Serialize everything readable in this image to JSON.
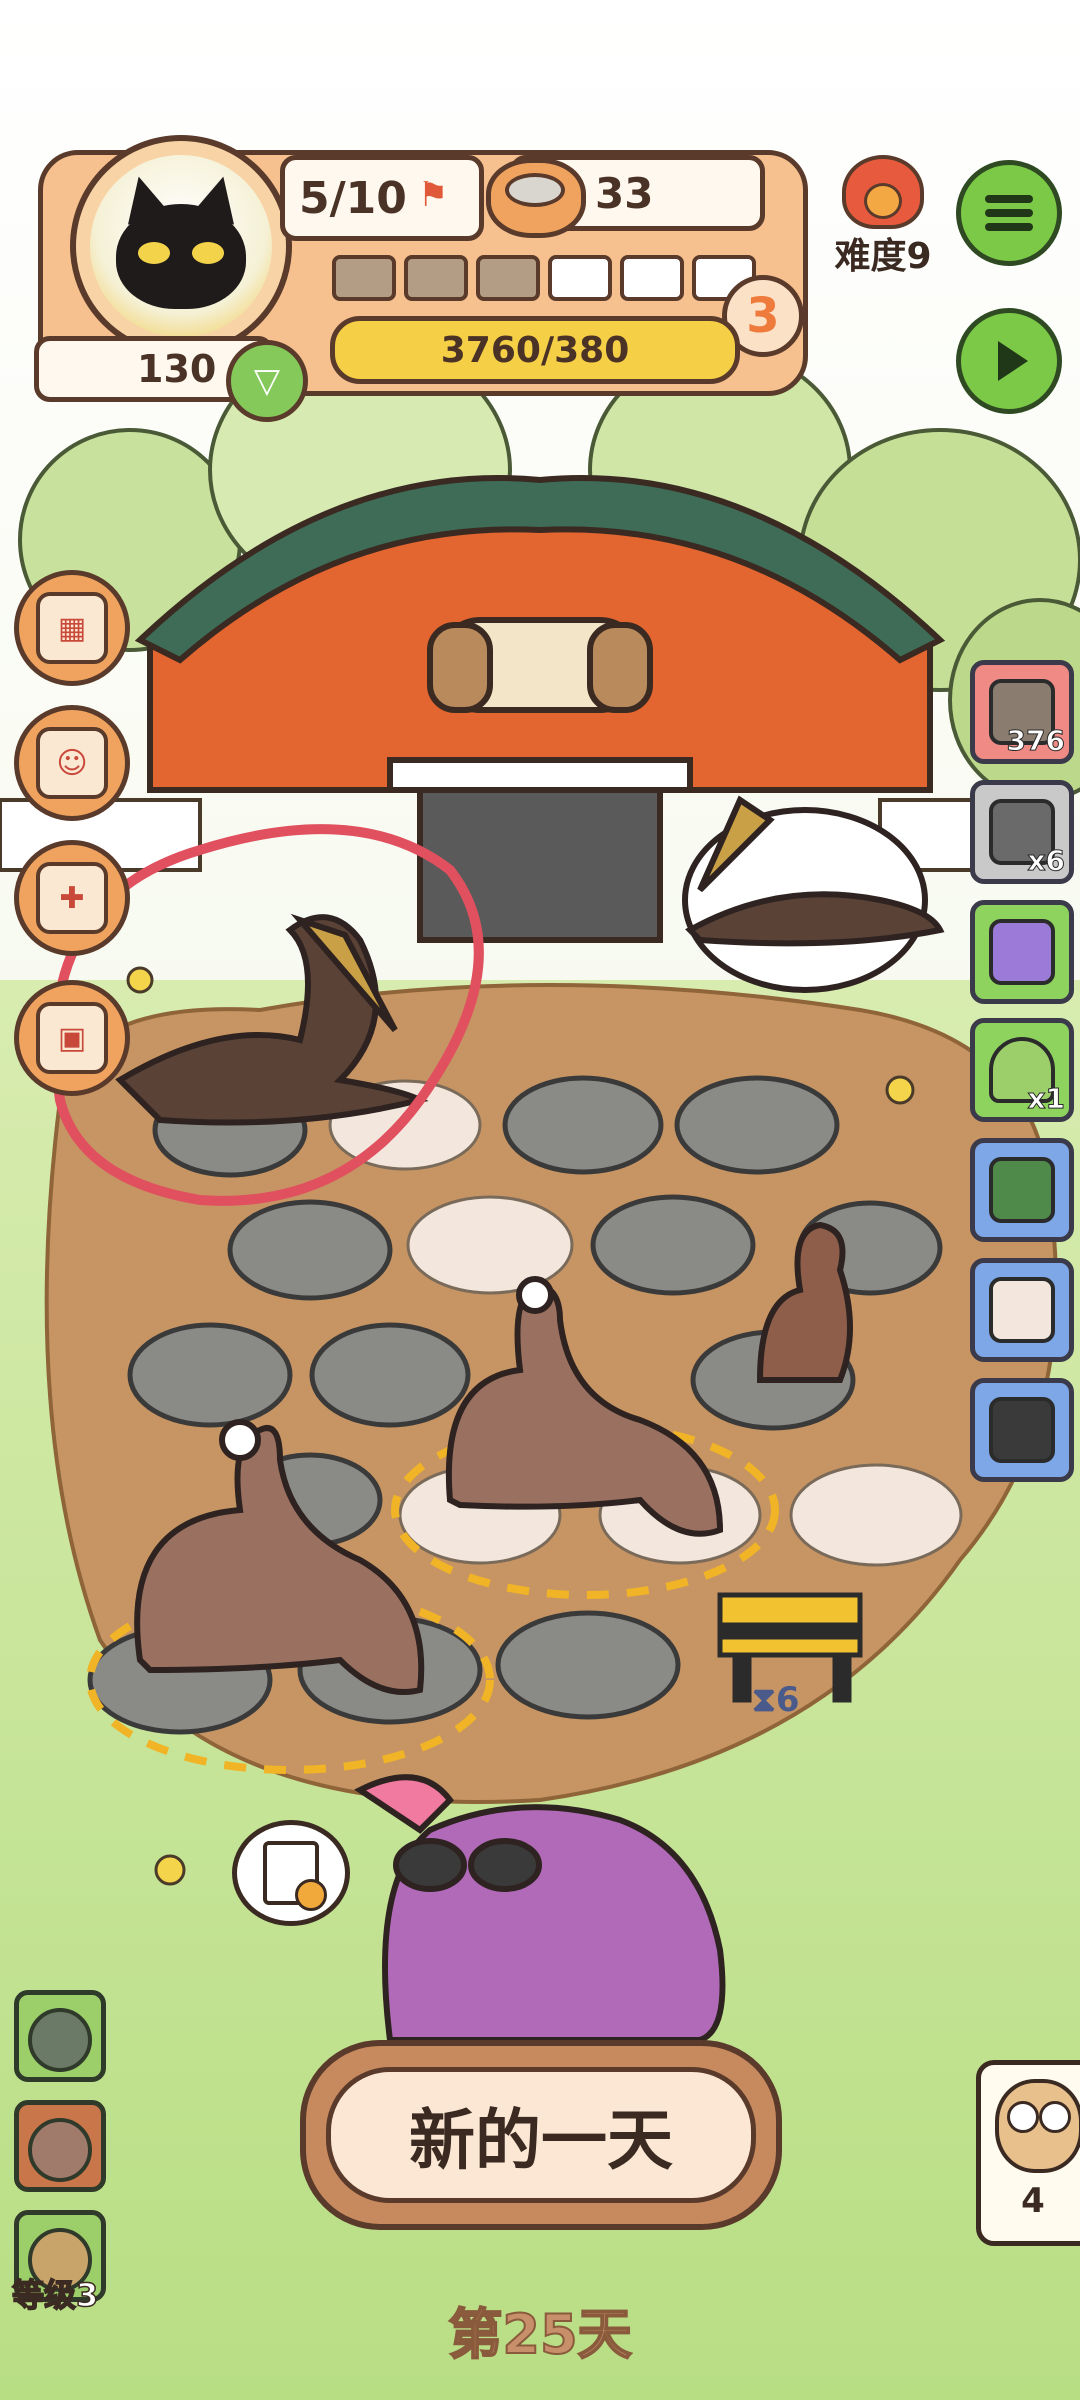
{
  "hud": {
    "population": "5/10",
    "food": "33",
    "xp": "3760/380",
    "level": "3",
    "coins": "130",
    "difficulty_label": "难度9",
    "progress_segments_filled": 3,
    "progress_segments_total": 6
  },
  "items": [
    {
      "name": "fossil-stones",
      "count": "376",
      "color": "#f08a84"
    },
    {
      "name": "compass-bag",
      "count": "x6",
      "color": "#c9c9c9"
    },
    {
      "name": "card",
      "count": "",
      "color": "#8fd35f"
    },
    {
      "name": "tent",
      "count": "x1",
      "color": "#8fd35f"
    },
    {
      "name": "sack",
      "count": "",
      "color": "#7da7e6"
    },
    {
      "name": "crate",
      "count": "",
      "color": "#7da7e6"
    },
    {
      "name": "camera",
      "count": "",
      "color": "#7da7e6"
    }
  ],
  "construction_timer": "6",
  "bottom": {
    "new_day_label": "新的一天",
    "day_label": "第25天",
    "player_level_label": "等级3",
    "owl_count": "4"
  },
  "colors": {
    "accent_green": "#7bc947",
    "panel_orange": "#f6c08f",
    "outline": "#5a3a2a",
    "annotation_red": "#e0505f"
  }
}
